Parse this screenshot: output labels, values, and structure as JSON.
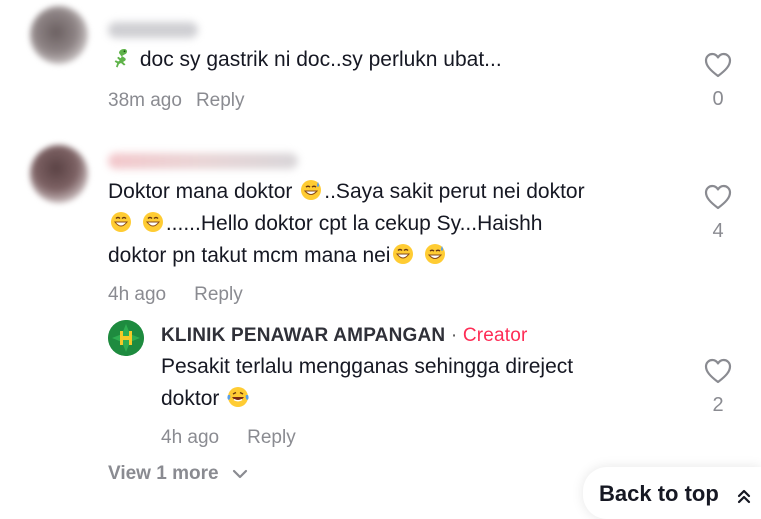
{
  "comments": [
    {
      "text": "doc sy gastrik ni doc..sy perlukn ubat...",
      "time": "38m ago",
      "reply_label": "Reply",
      "likes": "0"
    },
    {
      "line1": "Doktor mana doktor",
      "line1b": "..Saya sakit perut nei doktor",
      "line2": "......Hello doktor cpt la cekup Sy...Haishh",
      "line3": "doktor pn takut mcm mana nei",
      "time": "4h ago",
      "reply_label": "Reply",
      "likes": "4",
      "reply": {
        "author": "KLINIK PENAWAR AMPANGAN",
        "separator": "·",
        "badge": "Creator",
        "line1": "Pesakit terlalu mengganas sehingga direject",
        "line2": "doktor",
        "time": "4h ago",
        "reply_label": "Reply",
        "likes": "2"
      }
    }
  ],
  "view_more": "View 1 more",
  "back_to_top": "Back to top",
  "colors": {
    "creator": "#fe2c55",
    "muted": "#8a8b91",
    "text": "#161823"
  },
  "icons": [
    "heart-icon",
    "chevron-down-icon",
    "double-chevron-up-icon",
    "lizard-emoji-icon",
    "grin-sweat-emoji-icon",
    "grin-emoji-icon",
    "laugh-tears-emoji-icon"
  ]
}
